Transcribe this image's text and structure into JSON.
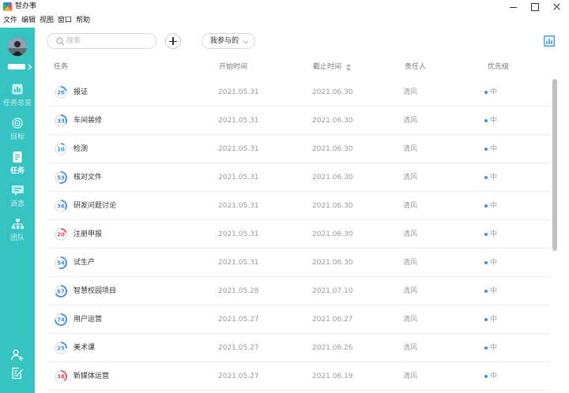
{
  "window": {
    "title": "智办事"
  },
  "menu": [
    "文件",
    "编辑",
    "视图",
    "窗口",
    "帮助"
  ],
  "sidebar": {
    "nav": [
      {
        "label": "任务总览",
        "icon": "overview-chart-icon",
        "active": false
      },
      {
        "label": "目标",
        "icon": "target-icon",
        "active": false
      },
      {
        "label": "任务",
        "icon": "task-document-icon",
        "active": true
      },
      {
        "label": "消息",
        "icon": "message-icon",
        "active": false
      },
      {
        "label": "团队",
        "icon": "team-icon",
        "active": false
      }
    ],
    "bottom_icons": [
      "add-member-icon",
      "edit-icon"
    ]
  },
  "toolbar": {
    "search_placeholder": "搜索",
    "filter_label": "我参与的"
  },
  "table": {
    "columns": {
      "task": "任务",
      "start": "开始时间",
      "end": "截止时间",
      "owner": "责任人",
      "priority": "优先级"
    },
    "rows": [
      {
        "progress": 20,
        "name": "报证",
        "start": "2021.05.31",
        "end": "2021.06.30",
        "owner": "清风",
        "priority": "中",
        "color": "#3b8fe6"
      },
      {
        "progress": 33,
        "name": "车间装修",
        "start": "2021.05.31",
        "end": "2021.06.30",
        "owner": "清风",
        "priority": "中",
        "color": "#3b8fe6"
      },
      {
        "progress": 10,
        "name": "检测",
        "start": "2021.05.31",
        "end": "2021.06.30",
        "owner": "清风",
        "priority": "中",
        "color": "#3b8fe6"
      },
      {
        "progress": 53,
        "name": "核对文件",
        "start": "2021.05.31",
        "end": "2021.06.30",
        "owner": "清风",
        "priority": "中",
        "color": "#3b8fe6"
      },
      {
        "progress": 36,
        "name": "研发问题讨论",
        "start": "2021.05.31",
        "end": "2021.06.30",
        "owner": "清风",
        "priority": "中",
        "color": "#3b8fe6"
      },
      {
        "progress": 20,
        "name": "注册申报",
        "start": "2021.05.31",
        "end": "2021.06.30",
        "owner": "清风",
        "priority": "中",
        "color": "#e8534f"
      },
      {
        "progress": 54,
        "name": "试生产",
        "start": "2021.05.31",
        "end": "2021.06.30",
        "owner": "清风",
        "priority": "中",
        "color": "#3b8fe6"
      },
      {
        "progress": 67,
        "name": "智慧校园项目",
        "start": "2021.05.28",
        "end": "2021.07.10",
        "owner": "清风",
        "priority": "中",
        "color": "#3b8fe6"
      },
      {
        "progress": 74,
        "name": "用户运营",
        "start": "2021.05.27",
        "end": "2021.06.27",
        "owner": "清风",
        "priority": "中",
        "color": "#3b8fe6"
      },
      {
        "progress": 25,
        "name": "美术课",
        "start": "2021.05.27",
        "end": "2021.06.26",
        "owner": "清风",
        "priority": "中",
        "color": "#3b8fe6"
      },
      {
        "progress": 38,
        "name": "新媒体运营",
        "start": "2021.05.27",
        "end": "2021.06.19",
        "owner": "清风",
        "priority": "中",
        "color": "#e8534f"
      }
    ]
  },
  "colors": {
    "sidebar": "#36c3c4",
    "accent": "#3b8fe6",
    "overdue": "#e8534f",
    "priority_dot": "#3b8fe6"
  }
}
